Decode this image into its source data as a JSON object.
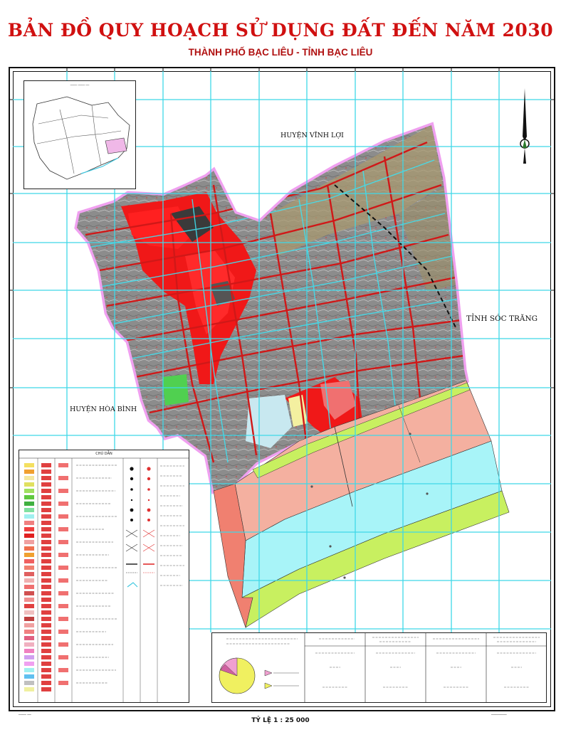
{
  "map": {
    "title": "BẢN ĐỒ QUY HOẠCH SỬ DỤNG ĐẤT ĐẾN NĂM 2030",
    "subtitle": "THÀNH PHỐ BẠC LIÊU - TỈNH BẠC LIÊU",
    "scale": "TỶ LỆ 1 : 25 000",
    "neighbors": {
      "north": "HUYỆN VĨNH LỢI",
      "east": "TỈNH SÓC TRĂNG",
      "west": "HUYỆN HÒA BÌNH"
    },
    "legend_title": "CHÚ DẪN",
    "north_arrow_icon": "north-arrow-icon",
    "colors": {
      "grid": "#3fd8e8",
      "urban_land": "#f01818",
      "rural_residential": "#8a8a8a",
      "sea_water": "#a8f4f8",
      "salmon_zone": "#f4b0a0",
      "green_belt": "#c8f060",
      "boundary": "#f0a0f0",
      "road": "#d01818"
    }
  }
}
